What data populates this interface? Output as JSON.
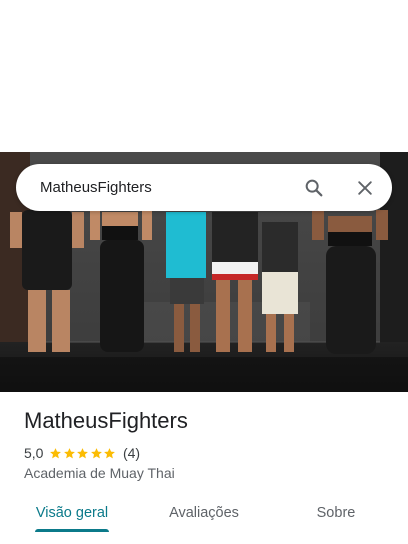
{
  "search": {
    "query": "MatheusFighters"
  },
  "place": {
    "name": "MatheusFighters",
    "rating": "5,0",
    "stars": 5,
    "review_count": "(4)",
    "category": "Academia de Muay Thai"
  },
  "tabs": [
    {
      "label": "Visão geral",
      "selected": true
    },
    {
      "label": "Avaliações",
      "selected": false
    },
    {
      "label": "Sobre",
      "selected": false
    }
  ],
  "colors": {
    "accent": "#0b7a8a",
    "star": "#fbbc04"
  },
  "icons": [
    "search-icon",
    "close-icon",
    "star-icon"
  ]
}
